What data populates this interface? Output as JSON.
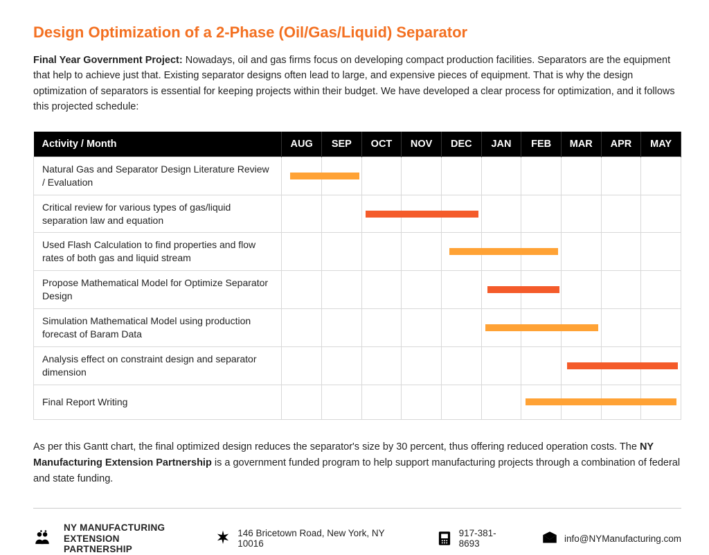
{
  "title": "Design Optimization of a 2-Phase (Oil/Gas/Liquid) Separator",
  "intro_lead": "Final Year Government Project:",
  "intro_body": " Nowadays, oil and gas firms focus on developing compact production facilities. Separators are the equipment that help to achieve just that. Existing separator designs often lead to large, and expensive pieces of equipment. That is why the design optimization of separators is essential for keeping projects within their budget. We have developed a clear process for optimization, and it follows this projected schedule:",
  "chart_data": {
    "type": "gantt",
    "months": [
      "AUG",
      "SEP",
      "OCT",
      "NOV",
      "DEC",
      "JAN",
      "FEB",
      "MAR",
      "APR",
      "MAY"
    ],
    "header_label": "Activity / Month",
    "activities": [
      {
        "label": "Natural Gas and Separator Design Literature Review / Evaluation",
        "start": 0.2,
        "end": 2.0,
        "color": "color1"
      },
      {
        "label": "Critical review for various types of gas/liquid separation law and equation",
        "start": 2.1,
        "end": 5.0,
        "color": "color2"
      },
      {
        "label": "Used Flash Calculation to find properties and flow rates of both gas and liquid stream",
        "start": 4.2,
        "end": 7.0,
        "color": "color1"
      },
      {
        "label": "Propose Mathematical Model for Optimize Separator Design",
        "start": 5.15,
        "end": 7.0,
        "color": "color2"
      },
      {
        "label": "Simulation Mathematical Model using production forecast of Baram Data",
        "start": 5.1,
        "end": 8.0,
        "color": "color1"
      },
      {
        "label": "Analysis effect on constraint design and separator dimension",
        "start": 7.15,
        "end": 10.0,
        "color": "color2"
      },
      {
        "label": "Final Report Writing",
        "start": 6.1,
        "end": 10.0,
        "color": "color1"
      }
    ]
  },
  "outro_before": "As per this Gantt chart, the final optimized design reduces the separator's size by 30 percent, thus offering reduced operation costs. The ",
  "outro_org": "NY Manufacturing Extension Partnership",
  "outro_after": " is a government funded program to help support manufacturing projects through a combination of federal and state funding.",
  "footer": {
    "org_line1": "NY MANUFACTURING",
    "org_line2": "EXTENSION PARTNERSHIP",
    "address": "146 Bricetown Road, New York, NY 10016",
    "phone": "917-381-8693",
    "email": "info@NYManufacturing.com"
  }
}
